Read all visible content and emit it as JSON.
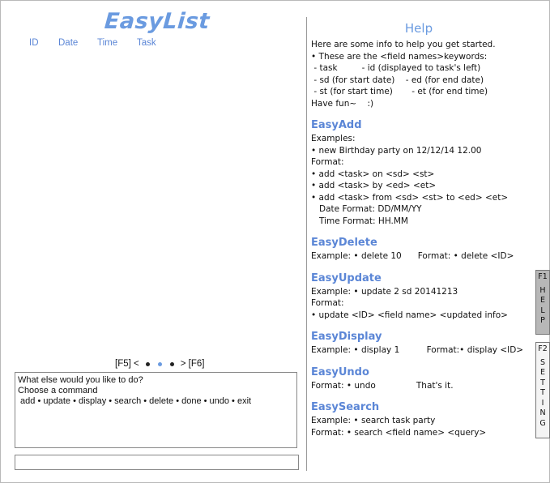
{
  "app": {
    "title": "EasyList"
  },
  "columns": [
    "ID",
    "Date",
    "Time",
    "Task"
  ],
  "pager": {
    "prev": "[F5] <",
    "next": "> [F6]",
    "page_count": 3,
    "active_page": 2
  },
  "command_area": {
    "line1": "What else would you like to do?",
    "line2": "Choose a command",
    "line3": " add • update • display • search • delete • done • undo • exit"
  },
  "command_input": {
    "value": "",
    "placeholder": ""
  },
  "help": {
    "title": "Help",
    "intro": [
      "Here are some info to help you get started.",
      "• These are the <field names>keywords:",
      " - task         - id (displayed to task's left)",
      " - sd (for start date)    - ed (for end date)",
      " - st (for start time)       - et (for end time)",
      "Have fun~    :)"
    ],
    "sections": [
      {
        "title": "EasyAdd",
        "lines": [
          "Examples:",
          "• new Birthday party on 12/12/14 12.00",
          "Format:",
          "• add <task> on <sd> <st>",
          "• add <task> by <ed> <et>",
          "• add <task> from <sd> <st> to <ed> <et>",
          "   Date Format: DD/MM/YY",
          "   Time Format: HH.MM"
        ]
      },
      {
        "title": "EasyDelete",
        "lines": [
          "Example: • delete 10      Format: • delete <ID>"
        ]
      },
      {
        "title": "EasyUpdate",
        "lines": [
          "Example: • update 2 sd 20141213",
          "Format:",
          "• update <ID> <field name> <updated info>"
        ]
      },
      {
        "title": "EasyDisplay",
        "lines": [
          "Example: • display 1          Format:• display <ID>"
        ]
      },
      {
        "title": "EasyUndo",
        "lines": [
          "Format: • undo               That's it."
        ]
      },
      {
        "title": "EasySearch",
        "lines": [
          "Example: • search task party",
          "Format: • search <field name> <query>"
        ]
      }
    ]
  },
  "side_tabs": [
    {
      "key": "F1",
      "label": "HELP",
      "active": true
    },
    {
      "key": "F2",
      "label": "SETTING",
      "active": false
    }
  ],
  "colors": {
    "accent": "#6b9be0",
    "tab_active": "#b7b7b7"
  }
}
